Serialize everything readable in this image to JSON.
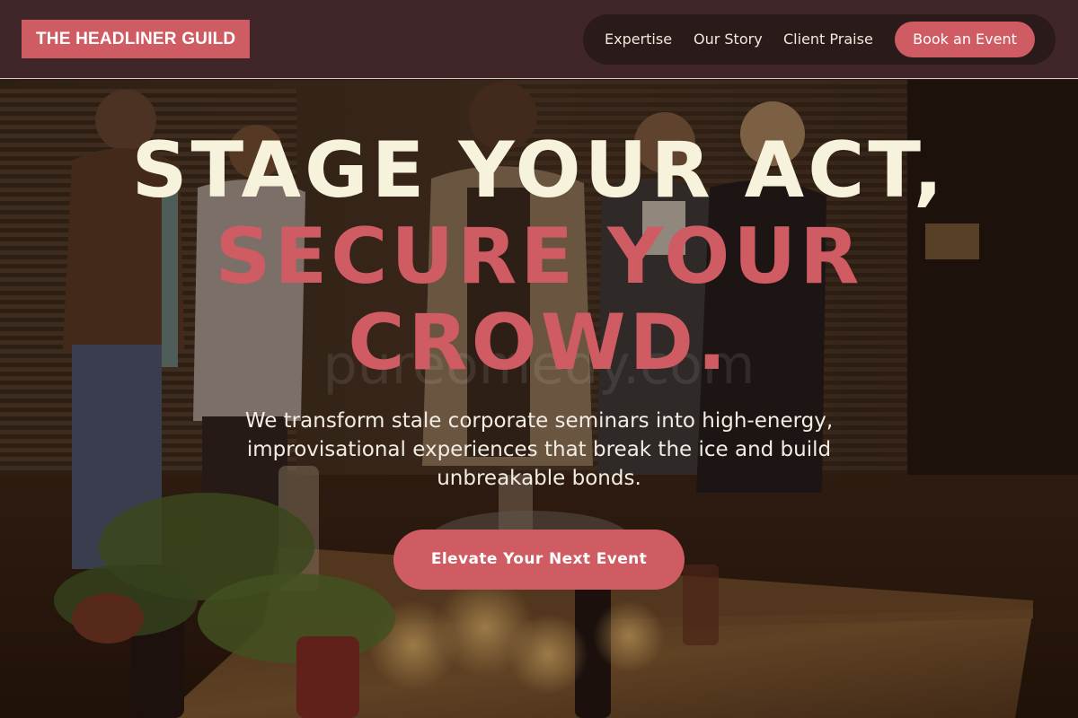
{
  "brand": {
    "logo_text": "THE HEADLINER GUILD",
    "accent_color": "#d05c63",
    "header_bg": "#402628",
    "nav_bg": "#2a1a1a",
    "headline_light_color": "#f6f2dc"
  },
  "nav": {
    "links": [
      {
        "label": "Expertise"
      },
      {
        "label": "Our Story"
      },
      {
        "label": "Client Praise"
      }
    ],
    "cta_label": "Book an Event"
  },
  "hero": {
    "headline_line1": "STAGE YOUR ACT,",
    "headline_line2": "SECURE YOUR",
    "headline_line3": "CROWD.",
    "watermark_text": "pureomedy.com",
    "subtitle": "We transform stale corporate seminars into high-energy, improvisational experiences that break the ice and build unbreakable bonds.",
    "cta_label": "Elevate Your Next Event"
  }
}
